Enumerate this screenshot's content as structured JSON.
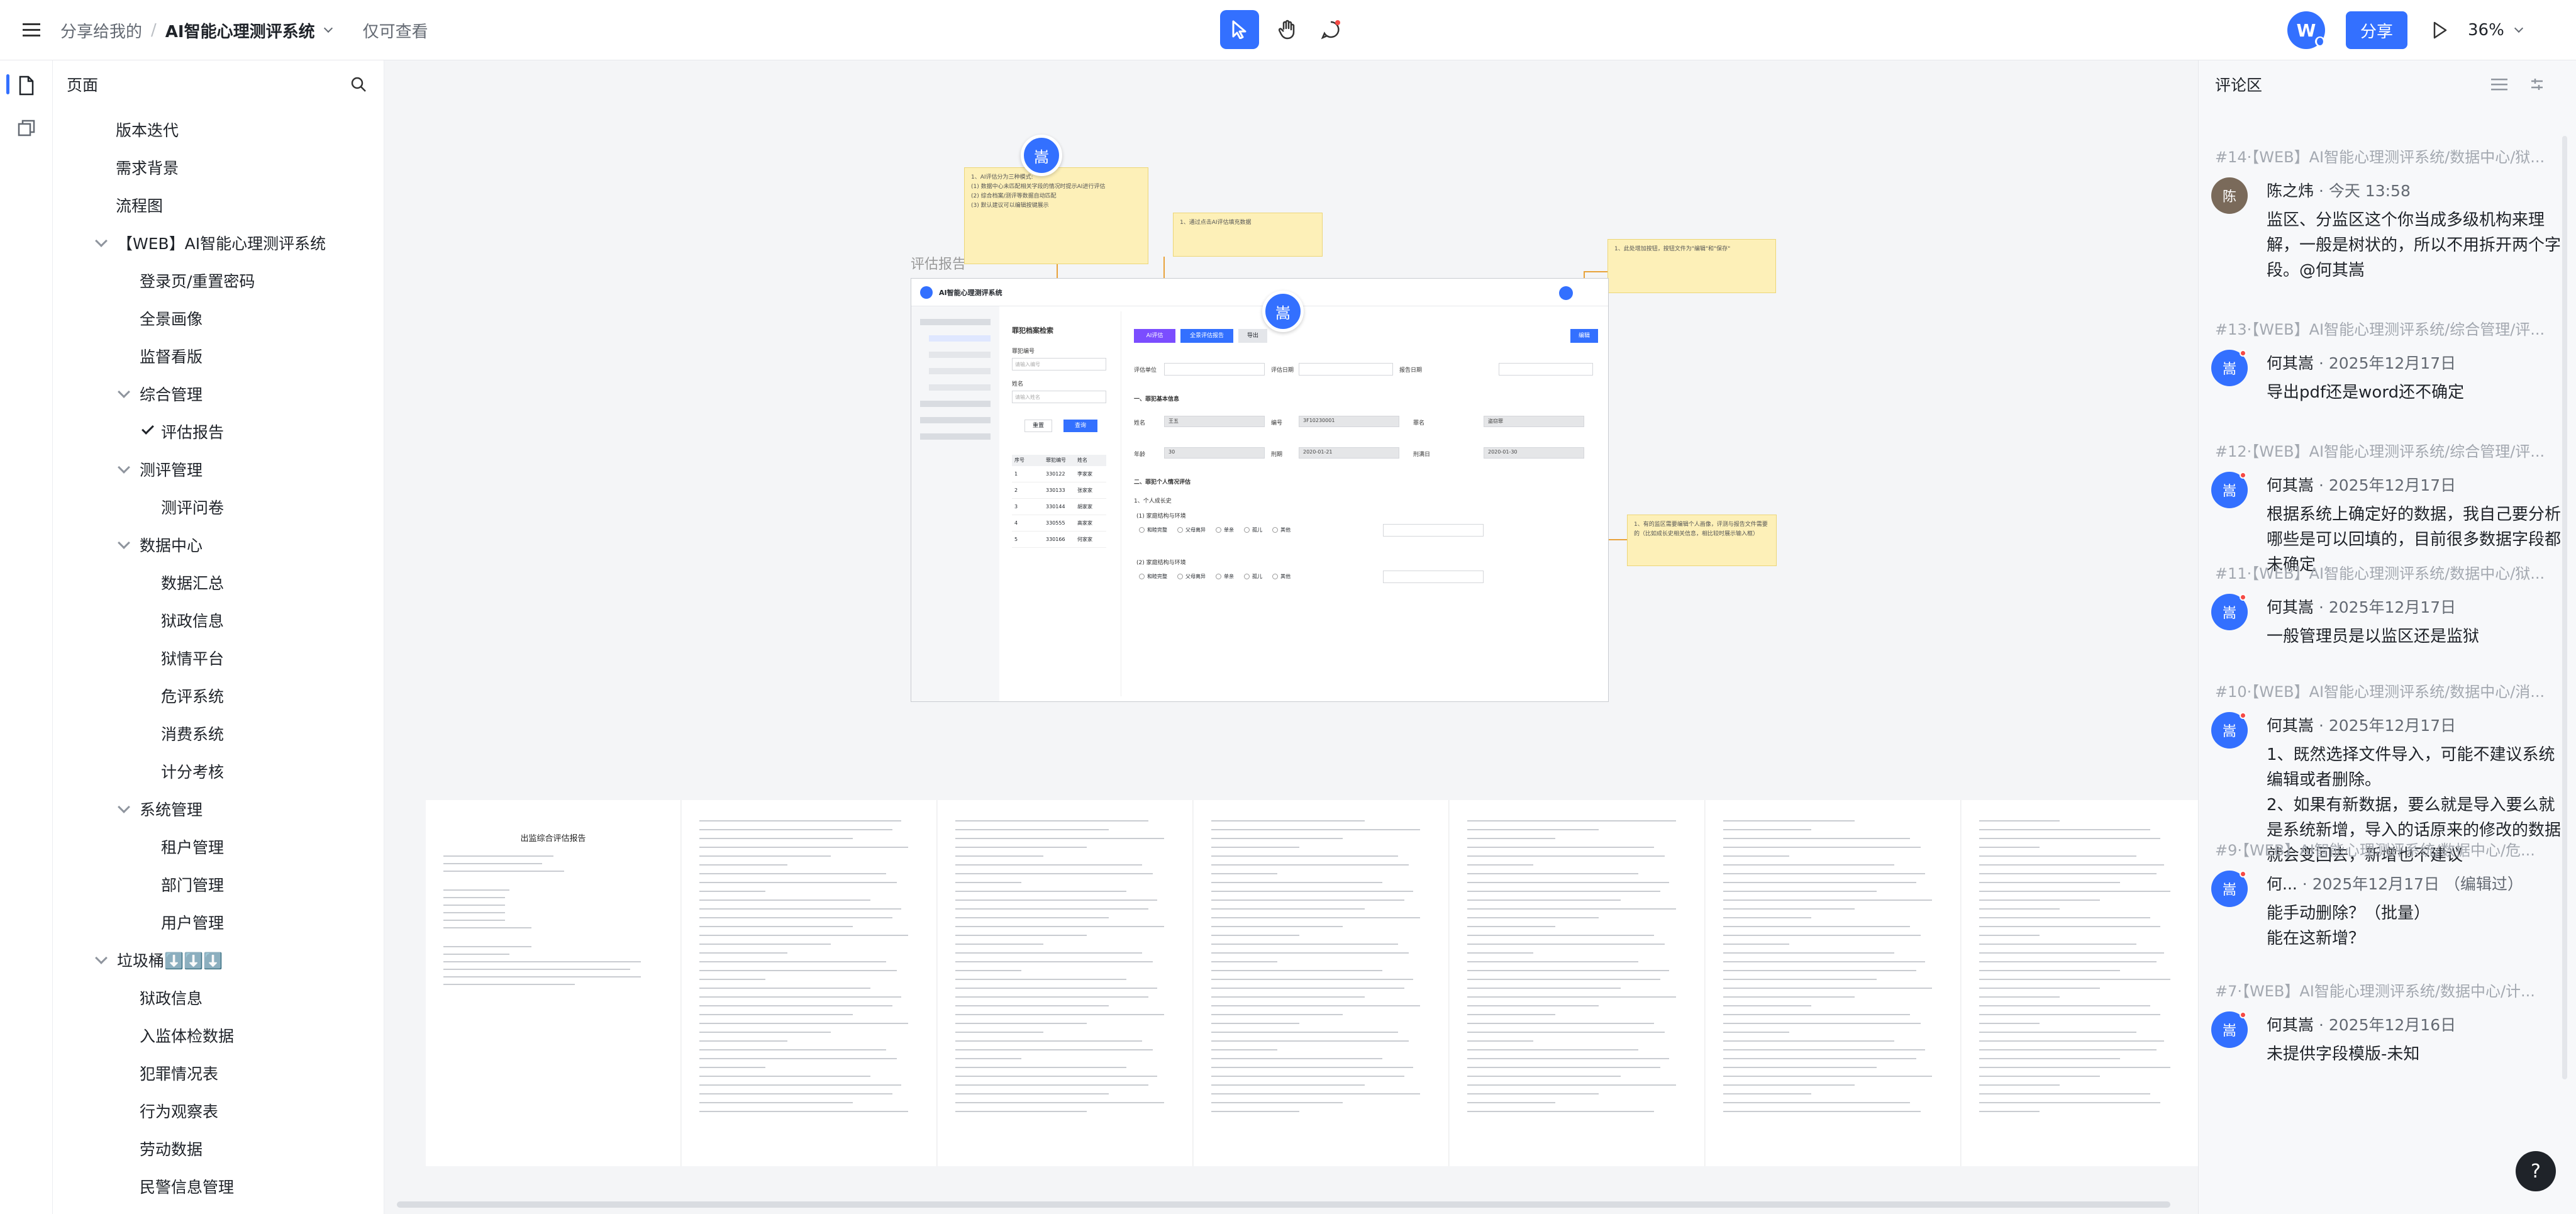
{
  "topbar": {
    "menu_icon": "menu-icon",
    "breadcrumb_parent": "分享给我的",
    "breadcrumb_sep": "/",
    "doc_title": "AI智能心理测评系统",
    "permission": "仅可查看",
    "share_label": "分享",
    "avatar_letter": "W",
    "zoom": "36%"
  },
  "sidebar": {
    "title": "页面",
    "items": [
      {
        "label": "版本迭代"
      },
      {
        "label": "需求背景"
      },
      {
        "label": "流程图"
      },
      {
        "label": "【WEB】AI智能心理测评系统"
      },
      {
        "label": "登录页/重置密码"
      },
      {
        "label": "全景画像"
      },
      {
        "label": "监督看版"
      },
      {
        "label": "综合管理"
      },
      {
        "label": "评估报告"
      },
      {
        "label": "测评管理"
      },
      {
        "label": "测评问卷"
      },
      {
        "label": "数据中心"
      },
      {
        "label": "数据汇总"
      },
      {
        "label": "狱政信息"
      },
      {
        "label": "狱情平台"
      },
      {
        "label": "危评系统"
      },
      {
        "label": "消费系统"
      },
      {
        "label": "计分考核"
      },
      {
        "label": "系统管理"
      },
      {
        "label": "租户管理"
      },
      {
        "label": "部门管理"
      },
      {
        "label": "用户管理"
      },
      {
        "label": "垃圾桶⬇️⬇️⬇️"
      },
      {
        "label": "狱政信息"
      },
      {
        "label": "入监体检数据"
      },
      {
        "label": "犯罪情况表"
      },
      {
        "label": "行为观察表"
      },
      {
        "label": "劳动数据"
      },
      {
        "label": "民警信息管理"
      }
    ]
  },
  "canvas": {
    "frame_label": "评估报告",
    "app_title": "AI智能心理测评系统",
    "page_heading": "罪犯档案检索",
    "filter_label_1": "罪犯编号",
    "filter_ph_1": "请输入编号",
    "filter_label_2": "姓名",
    "filter_ph_2": "请输入姓名",
    "reset_btn": "重置",
    "query_btn": "查询",
    "table_headers": [
      "序号",
      "罪犯编号",
      "姓名"
    ],
    "table_rows": [
      [
        "1",
        "330122",
        "李家家"
      ],
      [
        "2",
        "330133",
        "张家家"
      ],
      [
        "3",
        "330144",
        "胡家家"
      ],
      [
        "4",
        "330555",
        "高家家"
      ],
      [
        "5",
        "330166",
        "何家家"
      ]
    ],
    "btn_ai": "AI评估",
    "btn_full": "全景评估报告",
    "btn_export": "导出",
    "btn_edit": "编辑",
    "assess_unit": "评估单位",
    "assess_date": "评估日期",
    "report_date": "报告日期",
    "sec1": "一、罪犯基本信息",
    "name_lbl": "姓名",
    "name_val": "王五",
    "code_lbl": "编号",
    "code_val": "3F10230001",
    "crime_lbl": "罪名",
    "crime_val": "盗窃罪",
    "age_lbl": "年龄",
    "age_val": "30",
    "term_lbl": "刑期",
    "term_val": "2020-01-21",
    "in_lbl": "刑满日",
    "in_val": "2020-01-30",
    "sec2": "二、罪犯个人情况评估",
    "sub1": "1、个人成长史",
    "q1": "(1) 家庭结构与环境",
    "q2": "(2) 家庭结构与环境",
    "options": [
      "和睦完整",
      "父母离异",
      "单亲",
      "孤儿",
      "其他"
    ],
    "notes": {
      "note1": "1、AI评估分为三种模式:\n(1) 数据中心未匹配相关字段的情况时提示AI进行评估\n(2) 综合档案/测评等数据自动匹配\n(3) 默认建议可以编辑按键展示",
      "note2": "1、通过点击AI评估填充数据",
      "note3": "1、此处增加按钮，按钮文件为\"编辑\"和\"保存\"",
      "note4": "1、有的监区需要编辑个人画像，评测与报告文件需要的（比如成长史相关信息，相比较时展示输入框）"
    },
    "pin_label": "嵩",
    "doc_title": "出监综合评估报告"
  },
  "comments": {
    "title": "评论区",
    "items": [
      {
        "context": "#14·【WEB】AI智能心理测评系统/数据中心/狱...",
        "author": "陈之炜",
        "time": "今天 13:58",
        "body": "监区、分监区这个你当成多级机构来理解，一般是树状的，所以不用拆开两个字段。@何其嵩",
        "avatar": "陈"
      },
      {
        "context": "#13·【WEB】AI智能心理测评系统/综合管理/评...",
        "author": "何其嵩",
        "time": "2025年12月17日",
        "body": "导出pdf还是word还不确定",
        "avatar": "嵩"
      },
      {
        "context": "#12·【WEB】AI智能心理测评系统/综合管理/评...",
        "author": "何其嵩",
        "time": "2025年12月17日",
        "body": "根据系统上确定好的数据，我自己要分析哪些是可以回填的，目前很多数据字段都未确定",
        "avatar": "嵩"
      },
      {
        "context": "#11·【WEB】AI智能心理测评系统/数据中心/狱...",
        "author": "何其嵩",
        "time": "2025年12月17日",
        "body": "一般管理员是以监区还是监狱",
        "avatar": "嵩"
      },
      {
        "context": "#10·【WEB】AI智能心理测评系统/数据中心/消...",
        "author": "何其嵩",
        "time": "2025年12月17日",
        "body": "1、既然选择文件导入，可能不建议系统编辑或者删除。\n2、如果有新数据，要么就是导入要么就是系统新增，导入的话原来的修改的数据就会变回去，新增也不建议",
        "avatar": "嵩"
      },
      {
        "context": "#9·【WEB】AI智能心理测评系统/数据中心/危...",
        "author": "何...",
        "time": "2025年12月17日 （编辑过）",
        "body": "能手动删除？（批量）\n能在这新增？",
        "avatar": "嵩"
      },
      {
        "context": "#7·【WEB】AI智能心理测评系统/数据中心/计...",
        "author": "何其嵩",
        "time": "2025年12月16日",
        "body": "未提供字段模版-未知",
        "avatar": "嵩"
      }
    ]
  },
  "help_label": "?",
  "colors": {
    "accent": "#3370ff",
    "sticky": "#fdf0b8",
    "purple": "#7b4dff"
  }
}
